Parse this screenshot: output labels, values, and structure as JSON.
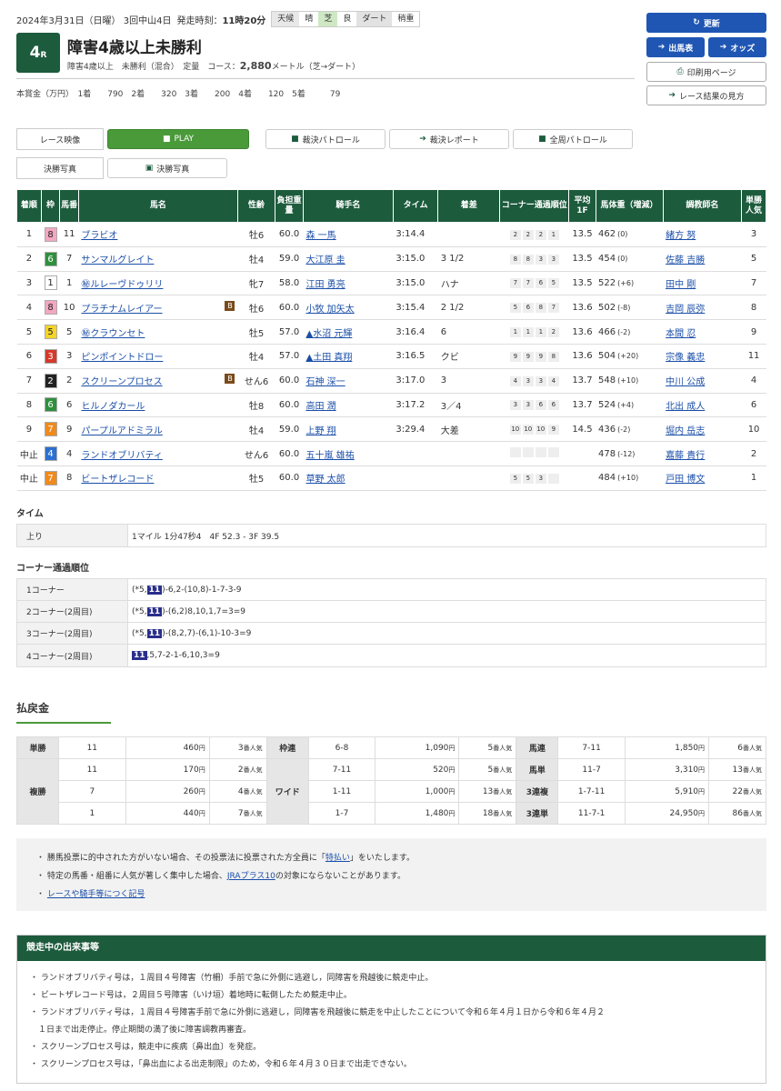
{
  "header": {
    "date": "2024年3月31日（日曜） 3回中山4日",
    "post_label": "発走時刻：",
    "post_time": "11時20分",
    "weather_label": "天候",
    "weather": "晴",
    "turf_label": "芝",
    "turf": "良",
    "dirt_label": "ダート",
    "dirt": "稍重",
    "race_num": "4",
    "race_suffix": "R",
    "race_name": "障害4歳以上未勝利",
    "cond": "障害4歳以上　未勝利（混合）　定量　コース：",
    "distance": "2,880",
    "course_tail": "メートル（芝→ダート）",
    "prize": "本賞金（万円）　1着　　790　2着　　320　3着　　200　4着　　120　5着　　　79"
  },
  "buttons": {
    "update": "更新",
    "entries": "出馬表",
    "odds": "オッズ",
    "print": "印刷用ページ",
    "howto": "レース結果の見方"
  },
  "video": {
    "label1": "レース映像",
    "play": "PLAY",
    "patrol": "裁決パトロール",
    "report": "裁決レポート",
    "full_patrol": "全周パトロール",
    "label2": "決勝写真",
    "photo": "決勝写真"
  },
  "table": {
    "headers": [
      "着順",
      "枠",
      "馬番",
      "馬名",
      "性齢",
      "負担重量",
      "騎手名",
      "タイム",
      "着差",
      "コーナー通過順位",
      "平均1F",
      "馬体重（増減）",
      "調教師名",
      "単勝人気"
    ],
    "rows": [
      {
        "pos": "1",
        "waku": "8",
        "num": "11",
        "horse": "ブラビオ",
        "sa": "牡6",
        "wt": "60.0",
        "jockey": "森 一馬",
        "time": "3:14.4",
        "margin": "",
        "corners": [
          "2",
          "2",
          "2",
          "1"
        ],
        "f1": "13.5",
        "bw": "462",
        "diff": "(0)",
        "trainer": "緒方 努",
        "pop": "3",
        "blink": ""
      },
      {
        "pos": "2",
        "waku": "6",
        "num": "7",
        "horse": "サンマルグレイト",
        "sa": "牡4",
        "wt": "59.0",
        "jockey": "大江原 圭",
        "time": "3:15.0",
        "margin": "3 1/2",
        "corners": [
          "8",
          "8",
          "3",
          "3"
        ],
        "f1": "13.5",
        "bw": "454",
        "diff": "(0)",
        "trainer": "佐藤 吉勝",
        "pop": "5",
        "blink": ""
      },
      {
        "pos": "3",
        "waku": "1",
        "num": "1",
        "horse": "㊙ルレーヴドゥリリ",
        "sa": "牝7",
        "wt": "58.0",
        "jockey": "江田 勇亮",
        "time": "3:15.0",
        "margin": "ハナ",
        "corners": [
          "7",
          "7",
          "6",
          "5"
        ],
        "f1": "13.5",
        "bw": "522",
        "diff": "(+6)",
        "trainer": "田中 剛",
        "pop": "7",
        "blink": ""
      },
      {
        "pos": "4",
        "waku": "8",
        "num": "10",
        "horse": "プラチナムレイアー",
        "sa": "牡6",
        "wt": "60.0",
        "jockey": "小牧 加矢太",
        "time": "3:15.4",
        "margin": "2 1/2",
        "corners": [
          "5",
          "6",
          "8",
          "7"
        ],
        "f1": "13.6",
        "bw": "502",
        "diff": "(-8)",
        "trainer": "吉岡 辰弥",
        "pop": "8",
        "blink": "B"
      },
      {
        "pos": "5",
        "waku": "5",
        "num": "5",
        "horse": "㊙クラウンセト",
        "sa": "牡5",
        "wt": "57.0",
        "jockey": "▲水沼 元輝",
        "time": "3:16.4",
        "margin": "6",
        "corners": [
          "1",
          "1",
          "1",
          "2"
        ],
        "f1": "13.6",
        "bw": "466",
        "diff": "(-2)",
        "trainer": "本間 忍",
        "pop": "9",
        "blink": ""
      },
      {
        "pos": "6",
        "waku": "3",
        "num": "3",
        "horse": "ピンポイントドロー",
        "sa": "牡4",
        "wt": "57.0",
        "jockey": "▲土田 真翔",
        "time": "3:16.5",
        "margin": "クビ",
        "corners": [
          "9",
          "9",
          "9",
          "8"
        ],
        "f1": "13.6",
        "bw": "504",
        "diff": "(+20)",
        "trainer": "宗像 義忠",
        "pop": "11",
        "blink": ""
      },
      {
        "pos": "7",
        "waku": "2",
        "num": "2",
        "horse": "スクリーンプロセス",
        "sa": "せん6",
        "wt": "60.0",
        "jockey": "石神 深一",
        "time": "3:17.0",
        "margin": "3",
        "corners": [
          "4",
          "3",
          "3",
          "4"
        ],
        "f1": "13.7",
        "bw": "548",
        "diff": "(+10)",
        "trainer": "中川 公成",
        "pop": "4",
        "blink": "B"
      },
      {
        "pos": "8",
        "waku": "6",
        "num": "6",
        "horse": "ヒルノダカール",
        "sa": "牡8",
        "wt": "60.0",
        "jockey": "高田 潤",
        "time": "3:17.2",
        "margin": "3／4",
        "corners": [
          "3",
          "3",
          "6",
          "6"
        ],
        "f1": "13.7",
        "bw": "524",
        "diff": "(+4)",
        "trainer": "北出 成人",
        "pop": "6",
        "blink": ""
      },
      {
        "pos": "9",
        "waku": "7",
        "num": "9",
        "horse": "パープルアドミラル",
        "sa": "牡4",
        "wt": "59.0",
        "jockey": "上野 翔",
        "time": "3:29.4",
        "margin": "大差",
        "corners": [
          "10",
          "10",
          "10",
          "9"
        ],
        "f1": "14.5",
        "bw": "436",
        "diff": "(-2)",
        "trainer": "堀内 岳志",
        "pop": "10",
        "blink": ""
      },
      {
        "pos": "中止",
        "waku": "4",
        "num": "4",
        "horse": "ランドオブリバティ",
        "sa": "せん6",
        "wt": "60.0",
        "jockey": "五十嵐 雄祐",
        "time": "",
        "margin": "",
        "corners": [
          "",
          "",
          "",
          ""
        ],
        "f1": "",
        "bw": "478",
        "diff": "(-12)",
        "trainer": "嘉藤 貴行",
        "pop": "2",
        "blink": ""
      },
      {
        "pos": "中止",
        "waku": "7",
        "num": "8",
        "horse": "ビートザレコード",
        "sa": "牡5",
        "wt": "60.0",
        "jockey": "草野 太郎",
        "time": "",
        "margin": "",
        "corners": [
          "5",
          "5",
          "3",
          ""
        ],
        "f1": "",
        "bw": "484",
        "diff": "(+10)",
        "trainer": "戸田 博文",
        "pop": "1",
        "blink": ""
      }
    ]
  },
  "time_section": {
    "title": "タイム",
    "label": "上り",
    "value": "1マイル 1分47秒4　4F 52.3 - 3F 39.5"
  },
  "corner_section": {
    "title": "コーナー通過順位",
    "rows": [
      {
        "label": "1コーナー",
        "pre": "(*5,",
        "hl": "11",
        "post": ")-6,2-(10,8)-1-7-3-9"
      },
      {
        "label": "2コーナー(2周目)",
        "pre": "(*5,",
        "hl": "11",
        "post": ")-(6,2)8,10,1,7=3=9"
      },
      {
        "label": "3コーナー(2周目)",
        "pre": "(*5,",
        "hl": "11",
        "post": ")-(8,2,7)-(6,1)-10-3=9"
      },
      {
        "label": "4コーナー(2周目)",
        "pre": "",
        "hl": "11",
        "post": ",5,7-2-1-6,10,3=9"
      }
    ]
  },
  "payout": {
    "title": "払戻金",
    "tan": {
      "label": "単勝",
      "num": "11",
      "amt": "460",
      "yen": "円",
      "pop": "3",
      "popl": "番人気"
    },
    "fuku_label": "複勝",
    "fuku": [
      {
        "num": "11",
        "amt": "170",
        "pop": "2"
      },
      {
        "num": "7",
        "amt": "260",
        "pop": "4"
      },
      {
        "num": "1",
        "amt": "440",
        "pop": "7"
      }
    ],
    "wakuren": {
      "label": "枠連",
      "num": "6-8",
      "amt": "1,090",
      "pop": "5"
    },
    "wide_label": "ワイド",
    "wide": [
      {
        "num": "7-11",
        "amt": "520",
        "pop": "5"
      },
      {
        "num": "1-11",
        "amt": "1,000",
        "pop": "13"
      },
      {
        "num": "1-7",
        "amt": "1,480",
        "pop": "18"
      }
    ],
    "right": [
      {
        "label": "馬連",
        "num": "7-11",
        "amt": "1,850",
        "pop": "6"
      },
      {
        "label": "馬単",
        "num": "11-7",
        "amt": "3,310",
        "pop": "13"
      },
      {
        "label": "3連複",
        "num": "1-7-11",
        "amt": "5,910",
        "pop": "22"
      },
      {
        "label": "3連単",
        "num": "11-7-1",
        "amt": "24,950",
        "pop": "86"
      }
    ]
  },
  "notes": {
    "n1a": "・ 勝馬投票に的中された方がいない場合、その投票法に投票された方全員に「",
    "n1link": "特払い",
    "n1b": "」をいたします。",
    "n2a": "・ 特定の馬番・組番に人気が著しく集中した場合、",
    "n2link": "JRAプラス10",
    "n2b": "の対象にならないことがあります。",
    "n3link": "レースや騎手等につく記号"
  },
  "incidents": {
    "title": "競走中の出来事等",
    "items": [
      "・ ランドオブリバティ号は，１周目４号障害（竹柵）手前で急に外側に逃避し，同障害を飛越後に競走中止。",
      "・ ビートザレコード号は，２周目５号障害（いけ垣）着地時に転倒したため競走中止。",
      "・ ランドオブリバティ号は，１周目４号障害手前で急に外側に逃避し，同障害を飛越後に競走を中止したことについて令和６年４月１日から令和６年４月２",
      "　１日まで出走停止。停止期間の満了後に障害調教再審査。",
      "・ スクリーンプロセス号は，競走中に疾病〔鼻出血〕を発症。",
      "・ スクリーンプロセス号は，「鼻出血による出走制限」のため，令和６年４月３０日まで出走できない。"
    ]
  },
  "colors": {
    "header_green": "#1d5b3d",
    "link_blue": "#1a4ea8",
    "button_blue": "#1f56b3",
    "waku": {
      "1": "#ffffff",
      "2": "#222222",
      "3": "#d33a2c",
      "4": "#2b6fd1",
      "5": "#f2d42a",
      "6": "#2f8f3d",
      "7": "#f08a1c",
      "8": "#f4a7c0"
    }
  }
}
